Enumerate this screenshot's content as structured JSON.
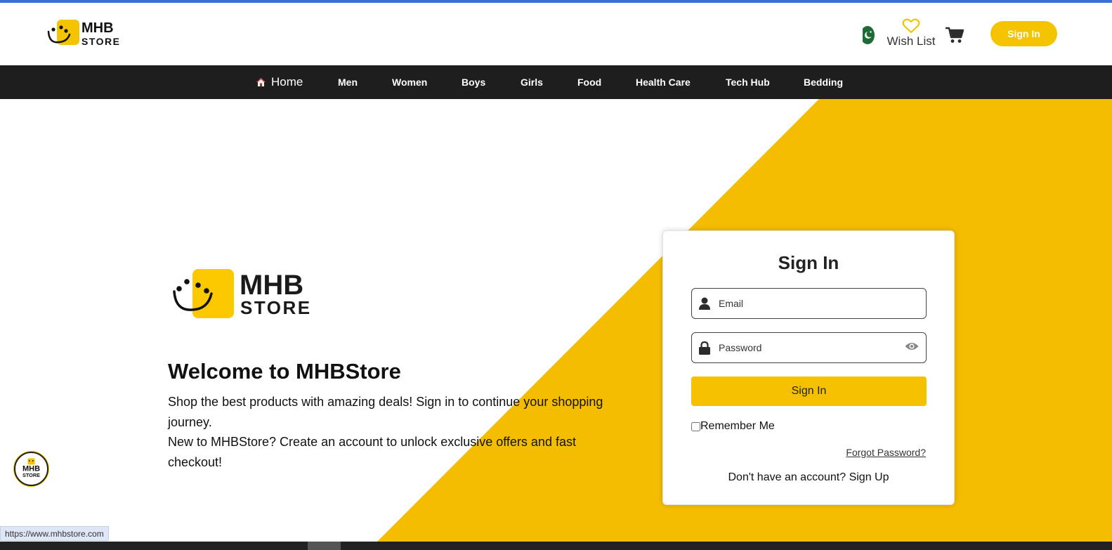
{
  "colors": {
    "accent": "#f5c400",
    "nav_background": "#1e1e1e",
    "top_accent": "#3a6fd8"
  },
  "header": {
    "logo_top": "MHB",
    "logo_bottom": "STORE",
    "flag_icon": "pakistan-flag-icon",
    "wishlist_icon": "heart-outline-icon",
    "wishlist_label": "Wish List",
    "cart_icon": "cart-icon",
    "signin_label": "Sign In"
  },
  "nav": {
    "home_icon": "house-icon",
    "items": [
      "Home",
      "Men",
      "Women",
      "Boys",
      "Girls",
      "Food",
      "Health Care",
      "Tech Hub",
      "Bedding"
    ]
  },
  "hero": {
    "logo_top": "MHB",
    "logo_bottom": "STORE",
    "title": "Welcome to MHBStore",
    "text_line1": "Shop the best products with amazing deals! Sign in to continue your shopping journey.",
    "text_line2": "New to MHBStore? Create an account to unlock exclusive offers and fast checkout!"
  },
  "signin_card": {
    "title": "Sign In",
    "email_placeholder": "Email",
    "password_placeholder": "Password",
    "button_label": "Sign In",
    "remember_label": "Remember Me",
    "forgot_label": "Forgot Password?",
    "signup_prompt": "Don't have an account?",
    "signup_link": "Sign Up"
  },
  "badge": {
    "logo_top": "MHB",
    "logo_bottom": "STORE"
  },
  "status_bar": {
    "url": "https://www.mhbstore.com"
  }
}
